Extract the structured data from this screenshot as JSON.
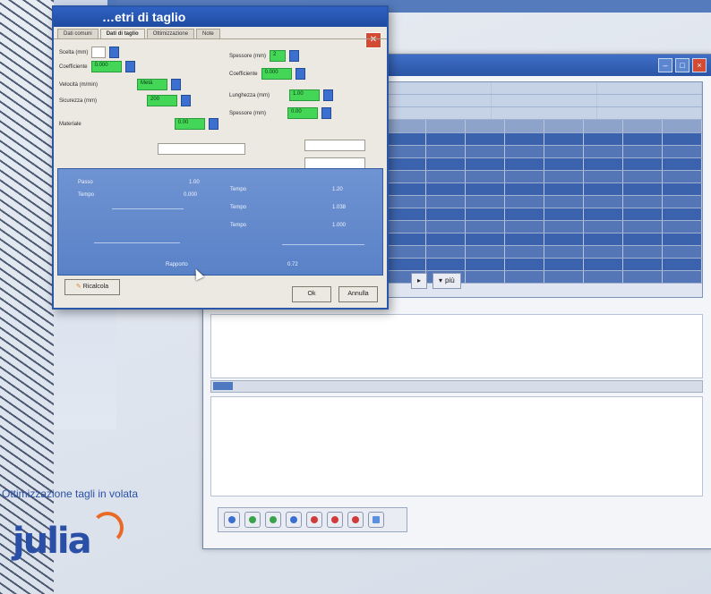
{
  "dialog": {
    "title": "…etri di taglio",
    "tabs": [
      "Dati comuni",
      "Dati di taglio",
      "Ottimizzazione",
      "Note"
    ],
    "close_glyph": "✕",
    "fields": [
      {
        "label": "Scelta (mm)",
        "value": "1"
      },
      {
        "label": "Coefficiente",
        "value": "0.000"
      },
      {
        "label": "Velocità (m/min)",
        "value": "Metà"
      },
      {
        "label": "Sicurezza (mm)",
        "value": "200"
      },
      {
        "label": "Materiale",
        "value": "0.00"
      },
      {
        "label": "Spessore (mm)",
        "value": "2"
      },
      {
        "label": "Coefficiente",
        "value": "0.000"
      },
      {
        "label": "Lunghezza (mm)",
        "value": "1.00"
      },
      {
        "label": "Spessore (mm)",
        "value": "0.00"
      }
    ],
    "results": [
      {
        "label": "Passo",
        "value": "1.00"
      },
      {
        "label": "Tempo",
        "value": "0.000"
      },
      {
        "label": "Tempo",
        "value": "1.20"
      },
      {
        "label": "Tempo",
        "value": "1.038"
      },
      {
        "label": "Tempo",
        "value": "1.000"
      },
      {
        "label": "Rapporto",
        "value": "0.72"
      }
    ],
    "buttons": {
      "calc": "Ricalcola",
      "ok": "Ok",
      "cancel": "Annulla"
    }
  },
  "main_window": {
    "tool_label": "più"
  },
  "branding": {
    "caption": "Ottimizzazione tagli in volata",
    "logo": "julia"
  }
}
